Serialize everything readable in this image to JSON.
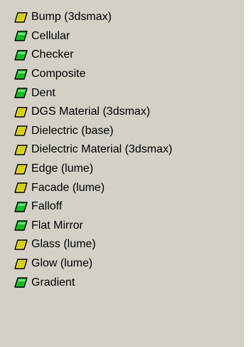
{
  "colors": {
    "panel_bg": "#d4d0c8",
    "text": "#000000",
    "green_icon": "#10c020",
    "yellow_icon": "#e6e020"
  },
  "items": [
    {
      "label": "Bump (3dsmax)",
      "icon": "yellow-map-icon"
    },
    {
      "label": "Cellular",
      "icon": "green-map-icon"
    },
    {
      "label": "Checker",
      "icon": "green-map-icon"
    },
    {
      "label": "Composite",
      "icon": "green-map-icon"
    },
    {
      "label": "Dent",
      "icon": "green-map-icon"
    },
    {
      "label": "DGS Material (3dsmax)",
      "icon": "yellow-map-icon"
    },
    {
      "label": "Dielectric (base)",
      "icon": "yellow-map-icon"
    },
    {
      "label": "Dielectric Material (3dsmax)",
      "icon": "yellow-map-icon"
    },
    {
      "label": "Edge (lume)",
      "icon": "yellow-map-icon"
    },
    {
      "label": "Facade (lume)",
      "icon": "yellow-map-icon"
    },
    {
      "label": "Falloff",
      "icon": "green-map-icon"
    },
    {
      "label": "Flat Mirror",
      "icon": "green-map-icon"
    },
    {
      "label": "Glass (lume)",
      "icon": "yellow-map-icon"
    },
    {
      "label": "Glow (lume)",
      "icon": "yellow-map-icon"
    },
    {
      "label": "Gradient",
      "icon": "green-map-icon"
    }
  ]
}
